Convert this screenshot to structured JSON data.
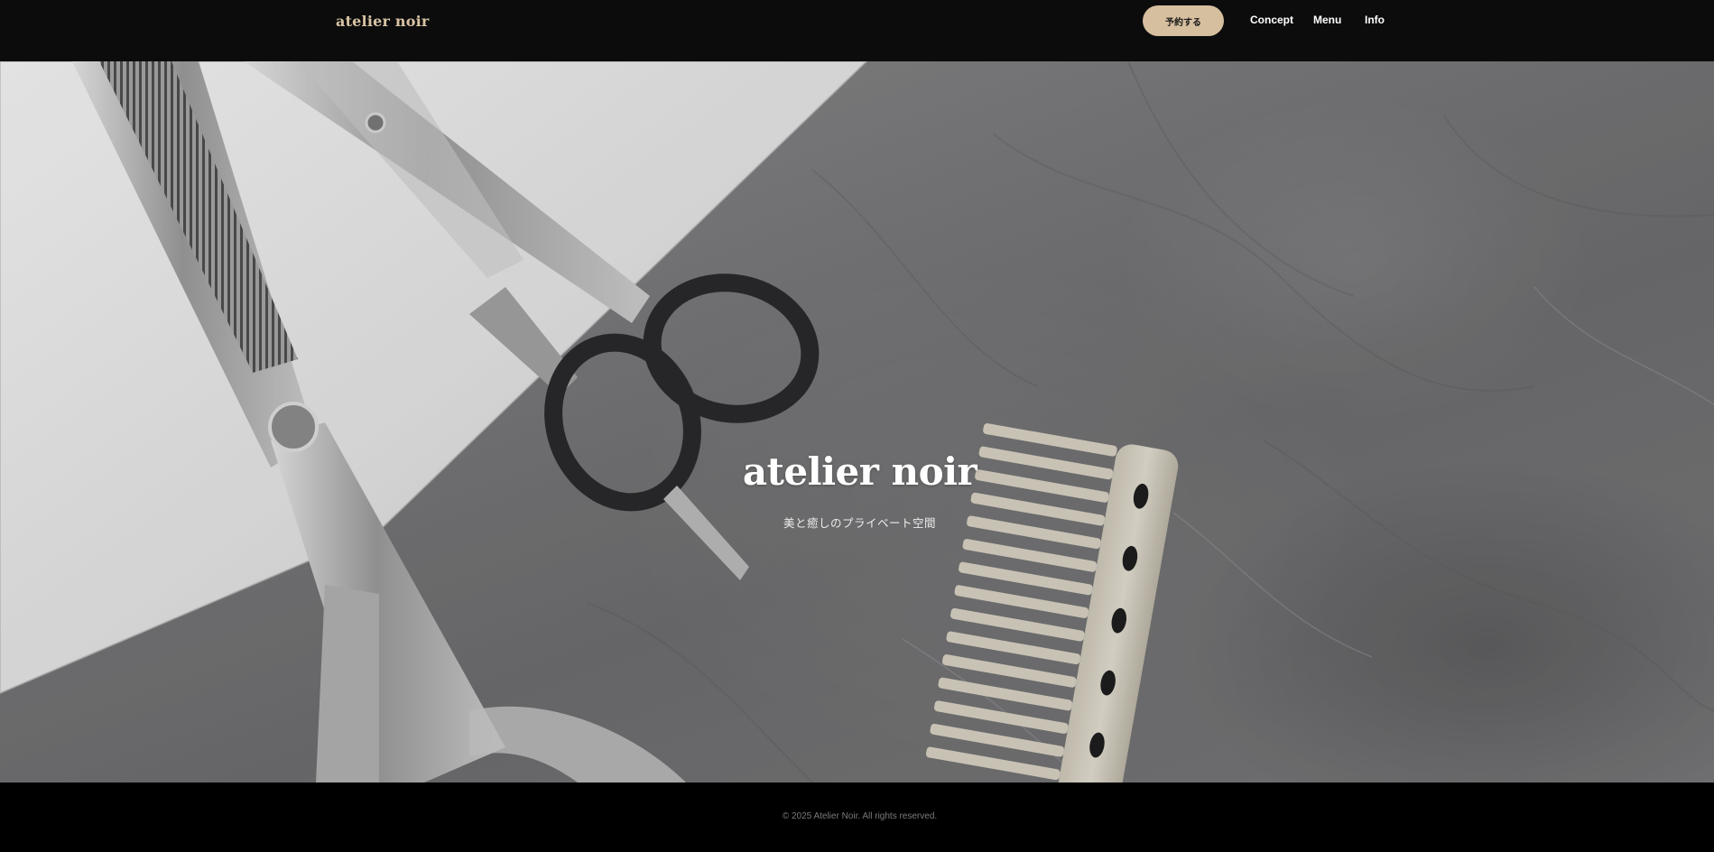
{
  "header": {
    "brand": "atelier noir",
    "reserve_label": "予約する",
    "nav": [
      {
        "label": "Concept"
      },
      {
        "label": "Menu"
      },
      {
        "label": "Info"
      }
    ]
  },
  "hero": {
    "title": "atelier noir",
    "subtitle": "美と癒しのプライベート空間"
  },
  "footer": {
    "copyright": "© 2025 Atelier Noir. All rights reserved."
  },
  "colors": {
    "header_bg": "#0c0c0c",
    "accent": "#d6bf9f",
    "footer_bg": "#000000",
    "text_light": "#ffffff"
  }
}
